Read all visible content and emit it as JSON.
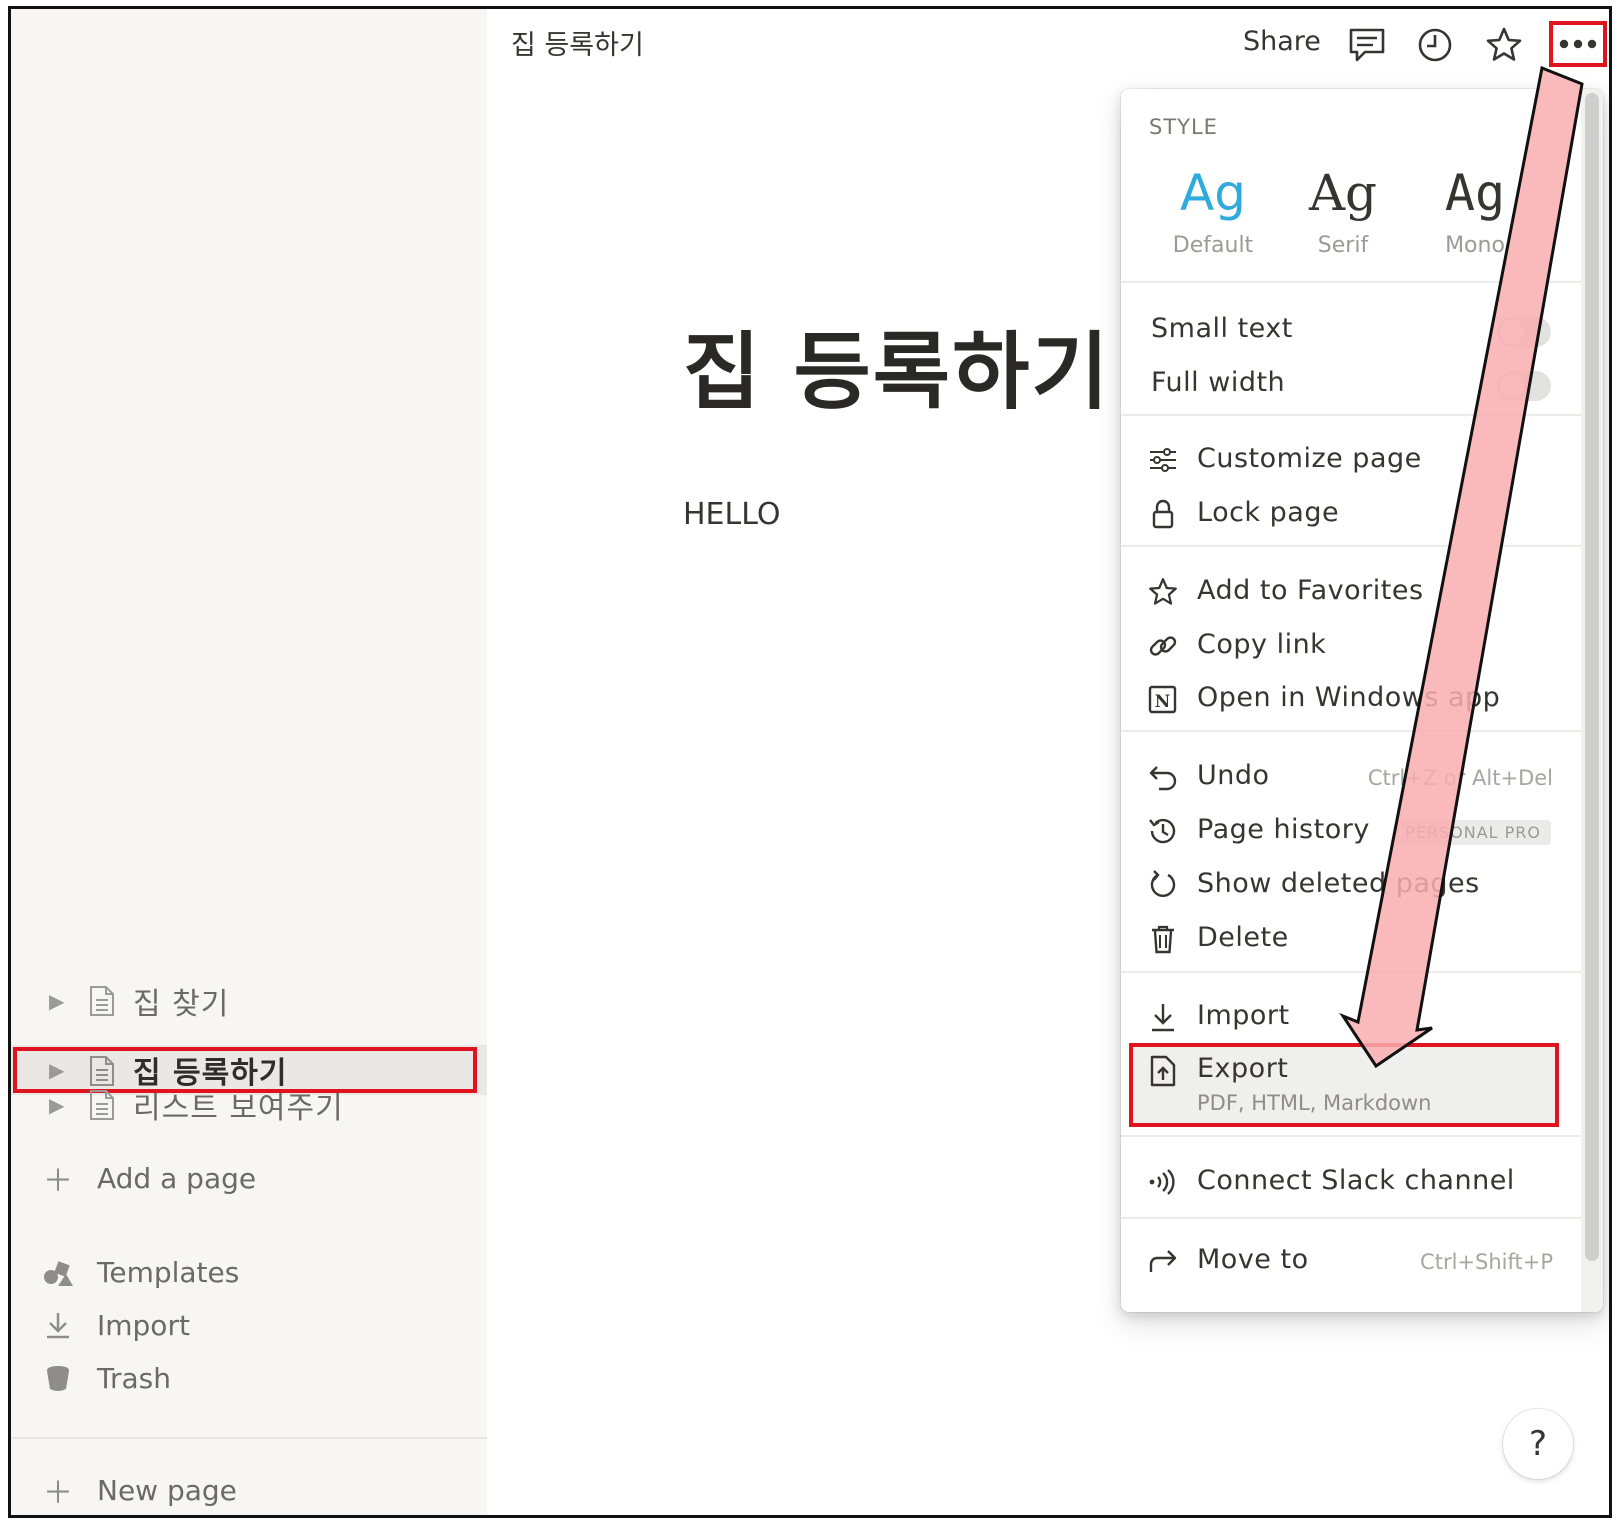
{
  "topbar": {
    "breadcrumb": "집 등록하기",
    "share_label": "Share",
    "icons": [
      "comment-icon",
      "clock-icon",
      "star-icon",
      "more-icon"
    ]
  },
  "page": {
    "title": "집 등록하기",
    "body": "HELLO"
  },
  "sidebar": {
    "pages": [
      {
        "label": "집 찾기",
        "active": false
      },
      {
        "label": "집 등록하기",
        "active": true
      },
      {
        "label": "리스트 보여주기",
        "active": false
      }
    ],
    "add_page": "Add a page",
    "templates": "Templates",
    "import": "Import",
    "trash": "Trash",
    "new_page": "New page"
  },
  "menu": {
    "style_label": "STYLE",
    "styles": [
      {
        "glyph": "Ag",
        "name": "Default"
      },
      {
        "glyph": "Ag",
        "name": "Serif"
      },
      {
        "glyph": "Ag",
        "name": "Mono"
      }
    ],
    "small_text": "Small text",
    "full_width": "Full width",
    "customize_page": "Customize page",
    "lock_page": "Lock page",
    "add_to_favorites": "Add to Favorites",
    "copy_link": "Copy link",
    "open_in_windows_app": "Open in Windows app",
    "undo": "Undo",
    "undo_shortcut": "Ctrl+Z or Alt+Del",
    "page_history": "Page history",
    "page_history_badge": "PERSONAL PRO",
    "show_deleted_pages": "Show deleted pages",
    "delete": "Delete",
    "import": "Import",
    "export": "Export",
    "export_sub": "PDF, HTML, Markdown",
    "connect_slack": "Connect Slack channel",
    "move_to": "Move to",
    "move_to_shortcut": "Ctrl+Shift+P"
  },
  "help_label": "?",
  "colors": {
    "highlight": "#e0141e",
    "arrow_fill": "#f9aeb0",
    "accent": "#2eaadc",
    "sidebar_bg": "#f7f6f3"
  }
}
